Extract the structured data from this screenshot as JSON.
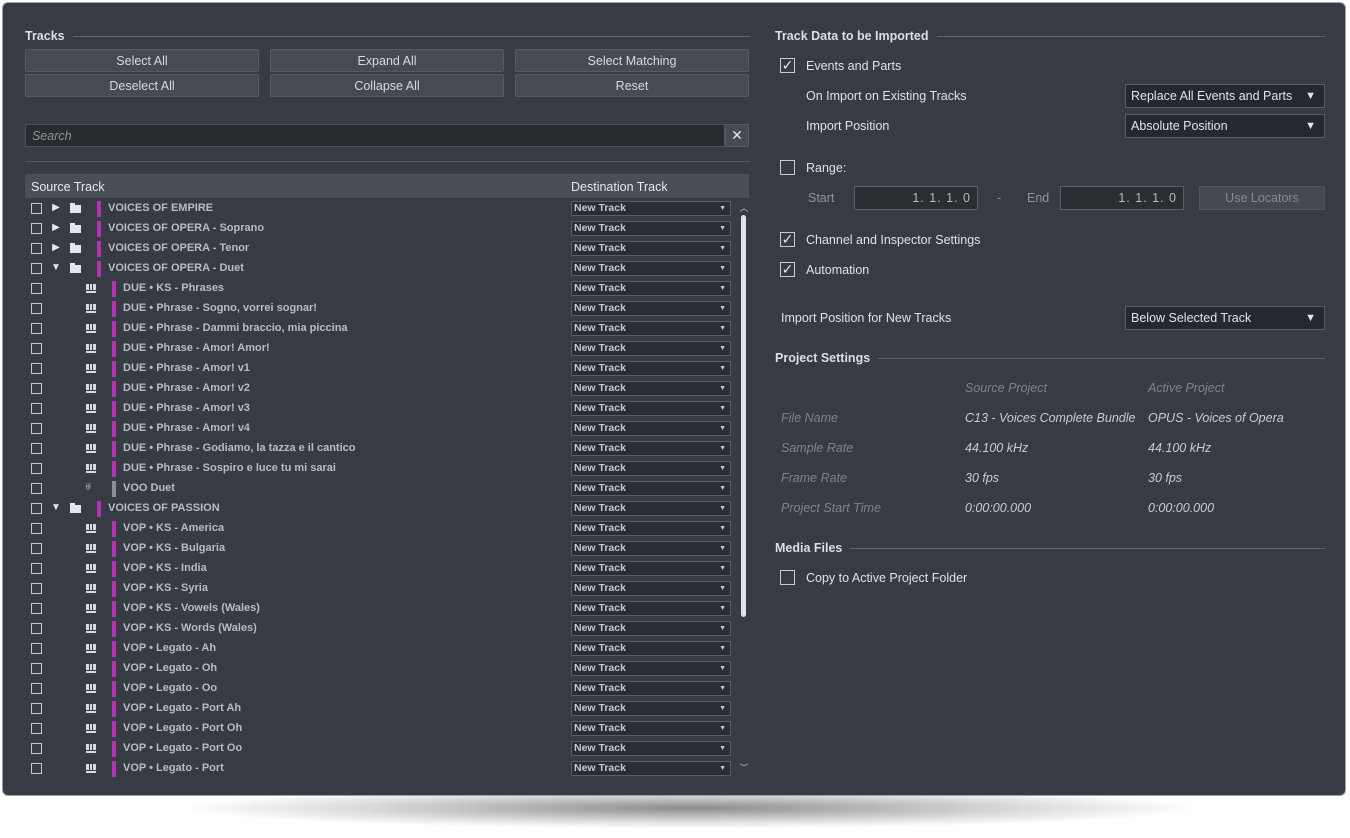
{
  "tracks": {
    "title": "Tracks",
    "buttons": {
      "select_all": "Select All",
      "deselect_all": "Deselect All",
      "expand_all": "Expand All",
      "collapse_all": "Collapse All",
      "select_matching": "Select Matching",
      "reset": "Reset"
    },
    "search_placeholder": "Search",
    "clear_icon": "✕",
    "columns": {
      "source": "Source Track",
      "destination": "Destination Track"
    },
    "rows": [
      {
        "name": "VOICES OF EMPIRE",
        "type": "folder",
        "level": 0,
        "expanded": false,
        "color": "#b432b4",
        "dest": "New Track"
      },
      {
        "name": "VOICES OF OPERA - Soprano",
        "type": "folder",
        "level": 0,
        "expanded": false,
        "color": "#b432b4",
        "dest": "New Track"
      },
      {
        "name": "VOICES OF OPERA - Tenor",
        "type": "folder",
        "level": 0,
        "expanded": false,
        "color": "#b432b4",
        "dest": "New Track"
      },
      {
        "name": "VOICES OF OPERA - Duet",
        "type": "folder",
        "level": 0,
        "expanded": true,
        "color": "#b432b4",
        "dest": "New Track"
      },
      {
        "name": "DUE • KS - Phrases",
        "type": "instrument",
        "level": 1,
        "color": "#b432b4",
        "dest": "New Track"
      },
      {
        "name": "DUE • Phrase - Sogno, vorrei sognar!",
        "type": "instrument",
        "level": 1,
        "color": "#b432b4",
        "dest": "New Track"
      },
      {
        "name": "DUE • Phrase - Dammi braccio, mia piccina",
        "type": "instrument",
        "level": 1,
        "color": "#b432b4",
        "dest": "New Track"
      },
      {
        "name": "DUE • Phrase - Amor! Amor!",
        "type": "instrument",
        "level": 1,
        "color": "#b432b4",
        "dest": "New Track"
      },
      {
        "name": "DUE • Phrase - Amor! v1",
        "type": "instrument",
        "level": 1,
        "color": "#b432b4",
        "dest": "New Track"
      },
      {
        "name": "DUE • Phrase - Amor! v2",
        "type": "instrument",
        "level": 1,
        "color": "#b432b4",
        "dest": "New Track"
      },
      {
        "name": "DUE • Phrase - Amor! v3",
        "type": "instrument",
        "level": 1,
        "color": "#b432b4",
        "dest": "New Track"
      },
      {
        "name": "DUE • Phrase - Amor! v4",
        "type": "instrument",
        "level": 1,
        "color": "#b432b4",
        "dest": "New Track"
      },
      {
        "name": "DUE • Phrase - Godiamo, la tazza e il cantico",
        "type": "instrument",
        "level": 1,
        "color": "#b432b4",
        "dest": "New Track"
      },
      {
        "name": "DUE • Phrase - Sospiro e luce tu mi sarai",
        "type": "instrument",
        "level": 1,
        "color": "#b432b4",
        "dest": "New Track"
      },
      {
        "name": "VOO Duet",
        "type": "drum",
        "level": 1,
        "color": "#8a8e95",
        "dest": "New Track"
      },
      {
        "name": "VOICES OF PASSION",
        "type": "folder",
        "level": 0,
        "expanded": true,
        "color": "#b432b4",
        "dest": "New Track"
      },
      {
        "name": "VOP • KS - America",
        "type": "instrument",
        "level": 1,
        "color": "#b432b4",
        "dest": "New Track"
      },
      {
        "name": "VOP • KS - Bulgaria",
        "type": "instrument",
        "level": 1,
        "color": "#b432b4",
        "dest": "New Track"
      },
      {
        "name": "VOP • KS - India",
        "type": "instrument",
        "level": 1,
        "color": "#b432b4",
        "dest": "New Track"
      },
      {
        "name": "VOP • KS - Syria",
        "type": "instrument",
        "level": 1,
        "color": "#b432b4",
        "dest": "New Track"
      },
      {
        "name": "VOP • KS - Vowels (Wales)",
        "type": "instrument",
        "level": 1,
        "color": "#b432b4",
        "dest": "New Track"
      },
      {
        "name": "VOP • KS - Words (Wales)",
        "type": "instrument",
        "level": 1,
        "color": "#b432b4",
        "dest": "New Track"
      },
      {
        "name": "VOP • Legato - Ah",
        "type": "instrument",
        "level": 1,
        "color": "#b432b4",
        "dest": "New Track"
      },
      {
        "name": "VOP • Legato - Oh",
        "type": "instrument",
        "level": 1,
        "color": "#b432b4",
        "dest": "New Track"
      },
      {
        "name": "VOP • Legato - Oo",
        "type": "instrument",
        "level": 1,
        "color": "#b432b4",
        "dest": "New Track"
      },
      {
        "name": "VOP • Legato - Port Ah",
        "type": "instrument",
        "level": 1,
        "color": "#b432b4",
        "dest": "New Track"
      },
      {
        "name": "VOP • Legato - Port Oh",
        "type": "instrument",
        "level": 1,
        "color": "#b432b4",
        "dest": "New Track"
      },
      {
        "name": "VOP • Legato - Port Oo",
        "type": "instrument",
        "level": 1,
        "color": "#b432b4",
        "dest": "New Track"
      },
      {
        "name": "VOP • Legato - Port",
        "type": "instrument",
        "level": 1,
        "color": "#b432b4",
        "dest": "New Track"
      }
    ]
  },
  "import": {
    "title": "Track Data to be Imported",
    "events_parts": {
      "label": "Events and Parts",
      "checked": true
    },
    "on_import_label": "On Import on Existing Tracks",
    "on_import_value": "Replace All Events and Parts",
    "import_position_label": "Import Position",
    "import_position_value": "Absolute Position",
    "range": {
      "label": "Range:",
      "checked": false
    },
    "start_label": "Start",
    "start_value": "1. 1. 1.  0",
    "dash": "-",
    "end_label": "End",
    "end_value": "1. 1. 1.  0",
    "use_locators": "Use Locators",
    "channel_settings": {
      "label": "Channel and Inspector Settings",
      "checked": true
    },
    "automation": {
      "label": "Automation",
      "checked": true
    },
    "new_tracks_pos_label": "Import Position for New Tracks",
    "new_tracks_pos_value": "Below Selected Track",
    "check_mark": "✓",
    "dropdown_caret": "▼"
  },
  "project": {
    "title": "Project Settings",
    "source_header": "Source Project",
    "active_header": "Active Project",
    "rows": [
      {
        "label": "File Name",
        "source": "C13 - Voices Complete Bundle",
        "active": "OPUS - Voices of Opera"
      },
      {
        "label": "Sample Rate",
        "source": "44.100 kHz",
        "active": "44.100 kHz"
      },
      {
        "label": "Frame Rate",
        "source": "30 fps",
        "active": "30 fps"
      },
      {
        "label": "Project Start Time",
        "source": "0:00:00.000",
        "active": "0:00:00.000"
      }
    ]
  },
  "media": {
    "title": "Media Files",
    "copy": {
      "label": "Copy to Active Project Folder",
      "checked": false
    }
  }
}
